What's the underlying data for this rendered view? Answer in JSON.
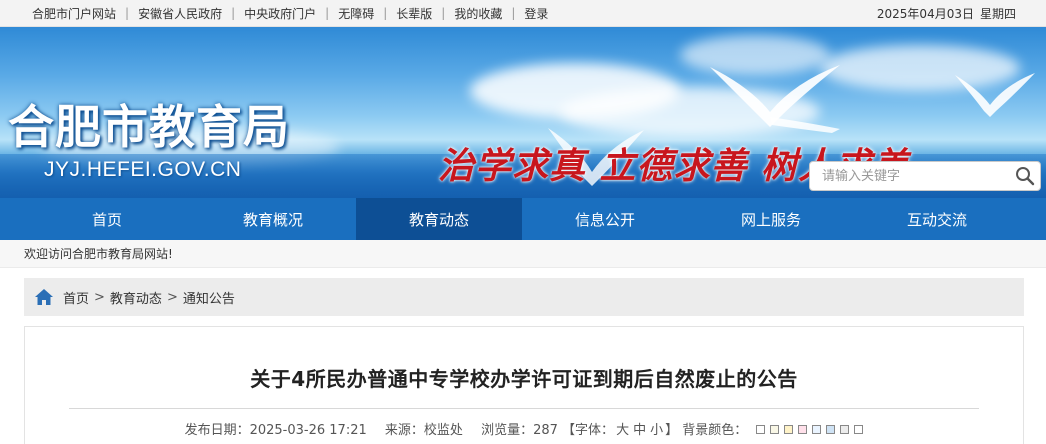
{
  "topbar": {
    "links": [
      "合肥市门户网站",
      "安徽省人民政府",
      "中央政府门户",
      "无障碍",
      "长辈版",
      "我的收藏",
      "登录"
    ],
    "date": "2025年04月03日",
    "weekday": "星期四"
  },
  "banner": {
    "title": "合肥市教育局",
    "url": "JYJ.HEFEI.GOV.CN",
    "slogan": "治学求真  立德求善  树人求美"
  },
  "search": {
    "placeholder": "请输入关键字",
    "icon": "search-icon"
  },
  "nav": {
    "items": [
      "首页",
      "教育概况",
      "教育动态",
      "信息公开",
      "网上服务",
      "互动交流"
    ],
    "active": "教育动态",
    "colors": {
      "bar": "#1a6fbf",
      "active": "#0d4f95"
    }
  },
  "welcome": "欢迎访问合肥市教育局网站!",
  "breadcrumb": {
    "icon": "home-icon",
    "items": [
      "首页",
      "教育动态",
      "通知公告"
    ],
    "separator": ">"
  },
  "article": {
    "title": "关于4所民办普通中专学校办学许可证到期后自然废止的公告",
    "publish_label": "发布日期：",
    "publish_date": "2025-03-26 17:21",
    "source_label": "来源：",
    "source": "校监处",
    "views_label": "浏览量：",
    "views": "287",
    "font_prefix": "【字体：",
    "font_sizes": [
      "大",
      "中",
      "小"
    ],
    "font_suffix": "】",
    "bg_label": "背景颜色：",
    "bg_colors": [
      "#ffffff",
      "#f9f7e6",
      "#fff3c8",
      "#ffe0ea",
      "#eaf4ff",
      "#cfe3f5",
      "#ececec",
      "#ffffff"
    ]
  },
  "colors": {
    "slogan": "#c8161d",
    "title_text": "#222222"
  }
}
